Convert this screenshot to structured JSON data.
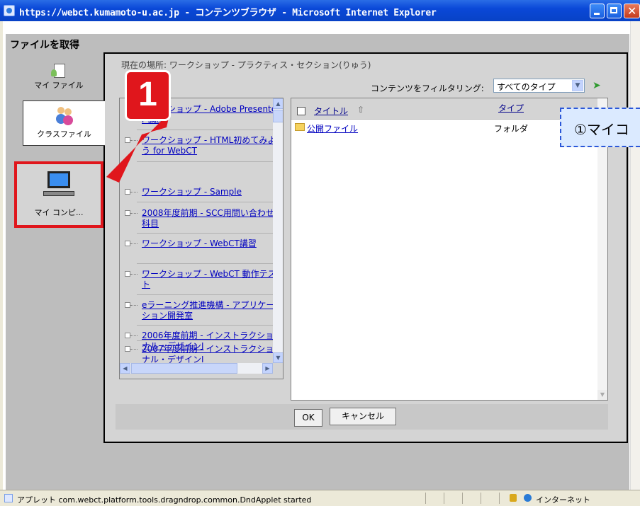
{
  "window": {
    "title": "https://webct.kumamoto-u.ac.jp - コンテンツブラウザ - Microsoft Internet Explorer"
  },
  "dialog": {
    "title": "ファイルを取得",
    "location": "現在の場所: ワークショップ - プラクティス・セクション(りゅう)",
    "filter_label": "コンテンツをフィルタリング:",
    "filter_value": "すべてのタイプ"
  },
  "tabs": {
    "my_files": "マイ ファイル",
    "class_files": "クラスファイル",
    "my_computer": "マイ コンピ..."
  },
  "tree": {
    "items": [
      "ワークショップ - Adobe Presenter 講座",
      "ワークショップ - HTML初めてみよう for WebCT",
      "ワークショップ - Sample",
      "2008年度前期 - SCC用問い合わせ科目",
      "ワークショップ - WebCT講習",
      "ワークショップ - WebCT 動作テスト",
      "eラーニング推進機構 - アプリケーション開発室",
      "2006年度前期 - インストラクショナル・デザインI",
      "2007年度前期 - インストラクショナル・デザインI"
    ]
  },
  "list": {
    "columns": {
      "title": "タイトル",
      "type": "タイプ"
    },
    "rows": [
      {
        "name": "公開ファイル",
        "type": "フォルダ"
      }
    ]
  },
  "buttons": {
    "ok": "OK",
    "cancel": "キャンセル"
  },
  "annotation": {
    "badge": "1",
    "callout": "①マイコ"
  },
  "status": {
    "text": "アプレット com.webct.platform.tools.dragndrop.common.DndApplet started",
    "zone": "インターネット"
  },
  "colors": {
    "highlight_red": "#e0161c",
    "callout_border": "#2b57d8",
    "link": "#0000c0"
  }
}
